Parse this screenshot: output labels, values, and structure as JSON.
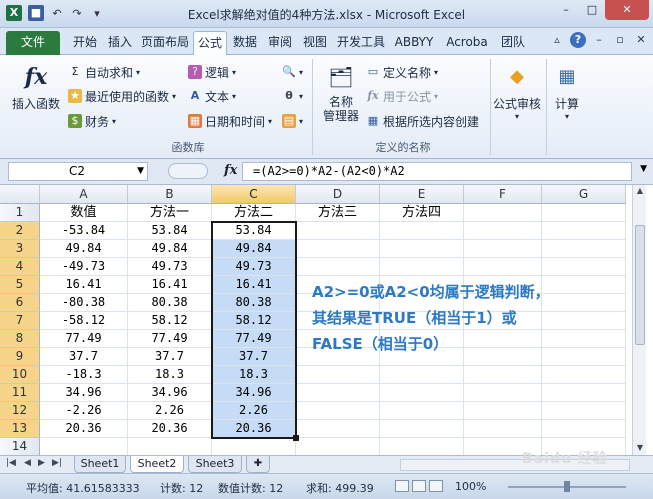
{
  "window": {
    "title": "Excel求解绝对值的4种方法.xlsx - Microsoft Excel",
    "qat": [
      "X",
      "💾",
      "↶",
      "↷",
      "▾"
    ],
    "controls": [
      "–",
      "□",
      "✕"
    ]
  },
  "tabs": [
    "文件",
    "开始",
    "插入",
    "页面布局",
    "公式",
    "数据",
    "审阅",
    "视图",
    "开发工具",
    "ABBYY",
    "Acroba",
    "团队"
  ],
  "tab_active": "公式",
  "ribbon": {
    "insert_function": "插入函数",
    "autosum": "自动求和",
    "recent": "最近使用的函数",
    "financial": "财务",
    "logical": "逻辑",
    "text": "文本",
    "datetime": "日期和时间",
    "group_library": "函数库",
    "name_manager": "名称\n管理器",
    "define_name": "定义名称",
    "use_in_formula": "用于公式",
    "create_from_sel": "根据所选内容创建",
    "group_names": "定义的名称",
    "auditing": "公式审核",
    "calculation": "计算"
  },
  "formula_bar": {
    "name_box": "C2",
    "fx": "fx",
    "formula": "=(A2>=0)*A2-(A2<0)*A2"
  },
  "columns": [
    "A",
    "B",
    "C",
    "D",
    "E",
    "F",
    "G"
  ],
  "rows": [
    "1",
    "2",
    "3",
    "4",
    "5",
    "6",
    "7",
    "8",
    "9",
    "10",
    "11",
    "12",
    "13",
    "14"
  ],
  "headers": [
    "数值",
    "方法一",
    "方法二",
    "方法三",
    "方法四"
  ],
  "data": [
    [
      "-53.84",
      "53.84",
      "53.84"
    ],
    [
      "49.84",
      "49.84",
      "49.84"
    ],
    [
      "-49.73",
      "49.73",
      "49.73"
    ],
    [
      "16.41",
      "16.41",
      "16.41"
    ],
    [
      "-80.38",
      "80.38",
      "80.38"
    ],
    [
      "-58.12",
      "58.12",
      "58.12"
    ],
    [
      "77.49",
      "77.49",
      "77.49"
    ],
    [
      "37.7",
      "37.7",
      "37.7"
    ],
    [
      "-18.3",
      "18.3",
      "18.3"
    ],
    [
      "34.96",
      "34.96",
      "34.96"
    ],
    [
      "-2.26",
      "2.26",
      "2.26"
    ],
    [
      "20.36",
      "20.36",
      "20.36"
    ]
  ],
  "annotation": [
    "A2>=0或A2<0均属于逻辑判断，",
    "其结果是TRUE（相当于1）或",
    "FALSE（相当于0）"
  ],
  "sheets": [
    "Sheet1",
    "Sheet2",
    "Sheet3"
  ],
  "active_sheet": "Sheet2",
  "status": {
    "average": "平均值: 41.61583333",
    "count": "计数: 12",
    "num_count": "数值计数: 12",
    "sum": "求和: 499.39",
    "zoom": "100%"
  },
  "watermark": "Baidu 经验",
  "colors": {
    "accent": "#2c79c5",
    "selection": "#c6dcf6",
    "file_tab": "#2b7a3e"
  }
}
